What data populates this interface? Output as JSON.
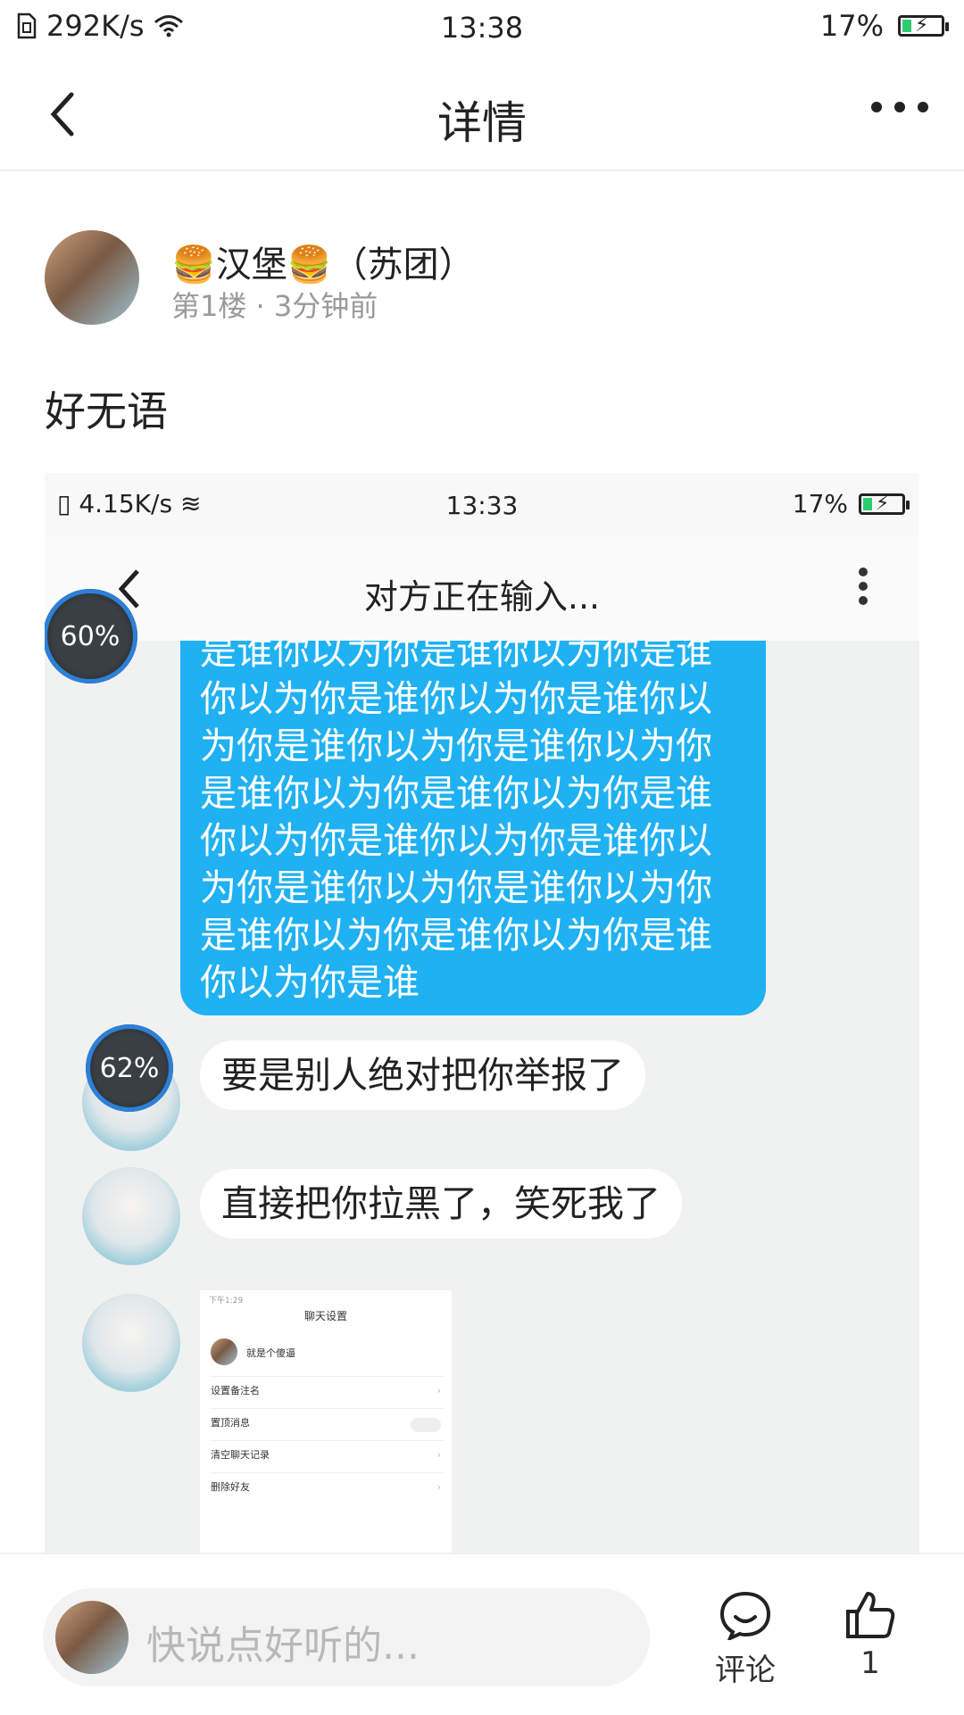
{
  "status_bar": {
    "speed": "292K/s",
    "time": "13:38",
    "battery": "17%"
  },
  "nav": {
    "title": "详情"
  },
  "post": {
    "user_name": "🍔汉堡🍔（苏团）",
    "meta": "第1楼 · 3分钟前",
    "text": "好无语"
  },
  "screenshot": {
    "status": {
      "speed": "4.15K/s",
      "time": "13:33",
      "battery": "17%"
    },
    "nav_title": "对方正在输入...",
    "progress_1": "60%",
    "progress_2": "62%",
    "blue_message": "是谁你以为你是谁你以为你是谁你以为你是谁你以为你是谁你以为你是谁你以为你是谁你以为你是谁你以为你是谁你以为你是谁你以为你是谁你以为你是谁你以为你是谁你以为你是谁你以为你是谁你以为你是谁你以为你是谁你以为你是谁",
    "messages": [
      "要是别人绝对把你举报了",
      "直接把你拉黑了，笑死我了"
    ],
    "inner": {
      "time": "下午1:29",
      "title": "聊天设置",
      "contact": "就是个傻逼",
      "rows": [
        "设置备注名",
        "置顶消息",
        "清空聊天记录",
        "删除好友"
      ]
    }
  },
  "bottom": {
    "placeholder": "快说点好听的...",
    "comment_label": "评论",
    "like_count": "1"
  }
}
